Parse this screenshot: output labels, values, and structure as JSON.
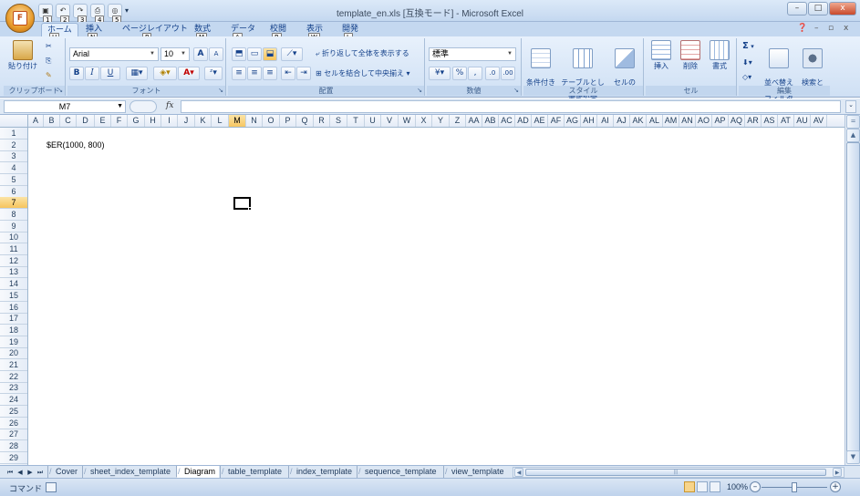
{
  "window": {
    "title": "template_en.xls  [互換モード] - Microsoft Excel",
    "office_keytip": "F",
    "qat_keytips": [
      "1",
      "2",
      "3",
      "4",
      "5"
    ],
    "minimize": "–",
    "maximize": "□",
    "close": "x"
  },
  "tabs": [
    {
      "label": "ホーム",
      "keytip": "H",
      "active": true
    },
    {
      "label": "挿入",
      "keytip": "N"
    },
    {
      "label": "ページレイアウト",
      "keytip": "P"
    },
    {
      "label": "数式",
      "keytip": "M"
    },
    {
      "label": "データ",
      "keytip": "A"
    },
    {
      "label": "校閲",
      "keytip": "R"
    },
    {
      "label": "表示",
      "keytip": "W"
    },
    {
      "label": "開発",
      "keytip": "L"
    }
  ],
  "ribbon": {
    "clipboard": {
      "label": "クリップボード",
      "paste": "貼り付け"
    },
    "font": {
      "label": "フォント",
      "name": "Arial",
      "size": "10",
      "bold": "B",
      "italic": "I",
      "underline": "U",
      "grow": "A",
      "shrink": "A"
    },
    "alignment": {
      "label": "配置",
      "wrap": "折り返して全体を表示する",
      "merge": "セルを結合して中央揃え"
    },
    "number": {
      "label": "数値",
      "format": "標準",
      "percent": "%",
      "comma": ","
    },
    "styles": {
      "label": "スタイル",
      "conditional": "条件付き\n書式",
      "table": "テーブルとして\n書式設定",
      "cell": "セルの\nスタイル"
    },
    "cells": {
      "label": "セル",
      "insert": "挿入",
      "delete": "削除",
      "format": "書式"
    },
    "editing": {
      "label": "編集",
      "sort": "並べ替えと\nフィルタ",
      "find": "検索と\n選択",
      "sum": "Σ"
    }
  },
  "formula_bar": {
    "name_box": "M7",
    "fx": "fx",
    "value": ""
  },
  "grid": {
    "columns": [
      "A",
      "B",
      "C",
      "D",
      "E",
      "F",
      "G",
      "H",
      "I",
      "J",
      "K",
      "L",
      "M",
      "N",
      "O",
      "P",
      "Q",
      "R",
      "S",
      "T",
      "U",
      "V",
      "W",
      "X",
      "Y",
      "Z",
      "AA",
      "AB",
      "AC",
      "AD",
      "AE",
      "AF",
      "AG",
      "AH",
      "AI",
      "AJ",
      "AK",
      "AL",
      "AM",
      "AN",
      "AO",
      "AP",
      "AQ",
      "AR",
      "AS",
      "AT",
      "AU",
      "AV"
    ],
    "rows": [
      "1",
      "2",
      "3",
      "4",
      "5",
      "6",
      "7",
      "8",
      "9",
      "10",
      "11",
      "12",
      "13",
      "14",
      "15",
      "16",
      "17",
      "18",
      "19",
      "20",
      "21",
      "22",
      "23",
      "24",
      "25",
      "26",
      "27",
      "28",
      "29"
    ],
    "selected_col": "M",
    "selected_row": "7",
    "cell_b2": "$ER(1000, 800)"
  },
  "sheets": [
    {
      "name": "Cover"
    },
    {
      "name": "sheet_index_template"
    },
    {
      "name": "Diagram",
      "active": true
    },
    {
      "name": "table_template"
    },
    {
      "name": "index_template"
    },
    {
      "name": "sequence_template"
    },
    {
      "name": "view_template"
    }
  ],
  "status": {
    "mode": "コマンド",
    "zoom": "100%"
  }
}
